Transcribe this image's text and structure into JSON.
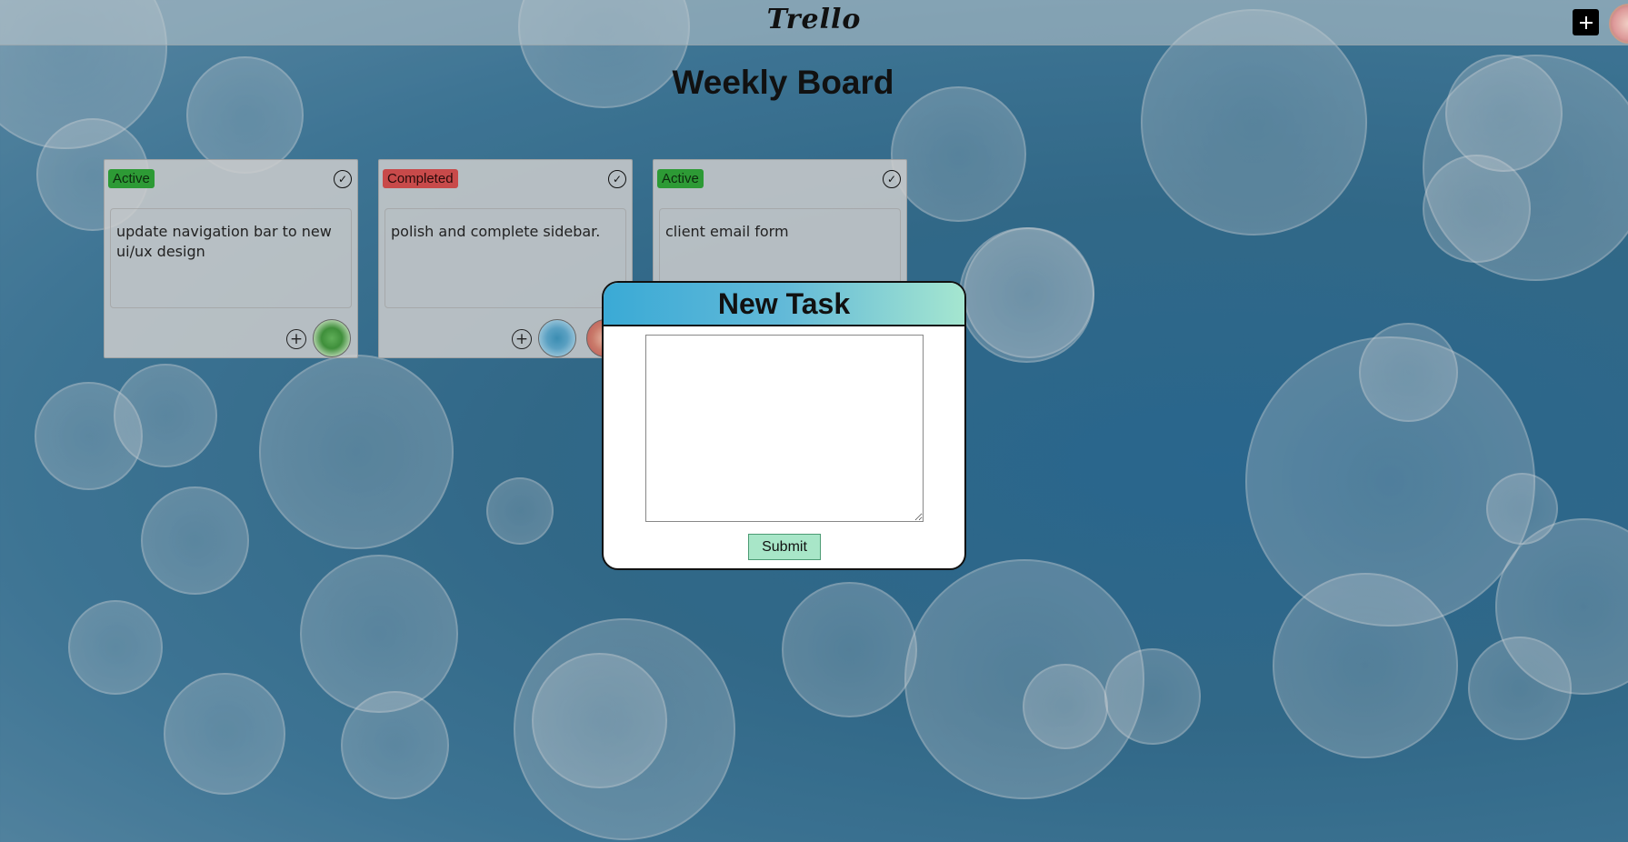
{
  "app": {
    "logo": "Trello"
  },
  "header": {
    "add_icon": "plus-icon",
    "avatar_icon": "user-avatar"
  },
  "board": {
    "title": "Weekly Board"
  },
  "cards": [
    {
      "status": "Active",
      "text": "update navigation bar to new ui/ux design"
    },
    {
      "status": "Completed",
      "text": "polish and complete sidebar."
    },
    {
      "status": "Active",
      "text": "client email form"
    }
  ],
  "modal": {
    "title": "New Task",
    "textarea_value": "",
    "submit_label": "Submit"
  },
  "colors": {
    "active": "#2d9a35",
    "completed": "#c84a4a",
    "submit": "#a8e6c8",
    "modal_header_start": "#3aaad6",
    "modal_header_end": "#a5e6d0"
  }
}
